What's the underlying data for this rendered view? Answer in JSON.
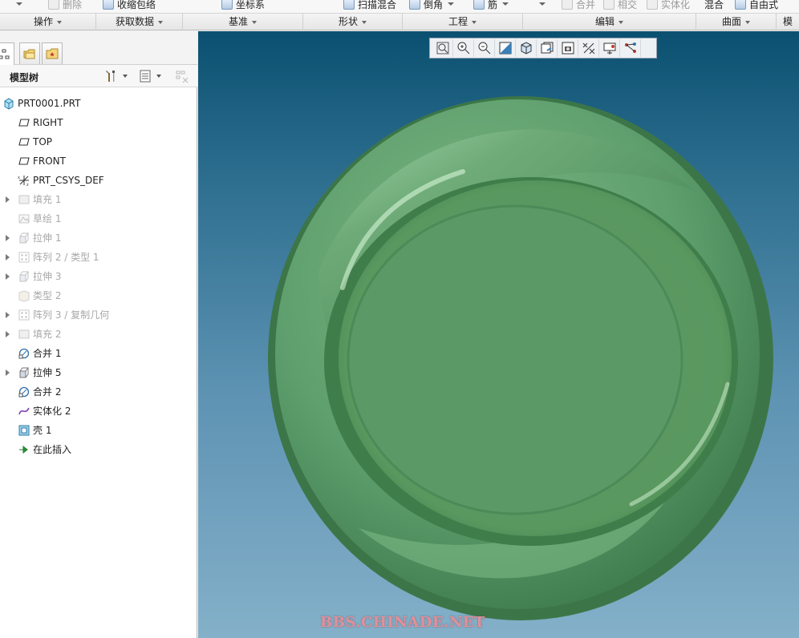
{
  "ribbon": {
    "top_items": [
      {
        "label": "删除",
        "dim": true
      },
      {
        "label": "收缩包络",
        "dim": false
      },
      {
        "label": "坐标系",
        "dim": false
      },
      {
        "label": "扫描混合",
        "dim": false
      },
      {
        "label": "倒角",
        "dim": false
      },
      {
        "label": "筋",
        "dim": false
      },
      {
        "label": "合并",
        "dim": true
      },
      {
        "label": "相交",
        "dim": true
      },
      {
        "label": "实体化",
        "dim": true
      },
      {
        "label": "混合",
        "dim": false
      },
      {
        "label": "自由式",
        "dim": false
      }
    ],
    "groups": [
      "操作",
      "获取数据",
      "基准",
      "形状",
      "工程",
      "编辑",
      "曲面",
      "模"
    ]
  },
  "panel": {
    "tree_title": "模型树"
  },
  "tree": [
    {
      "label": "PRT0001.PRT",
      "icon": "part-icon",
      "expand": false,
      "dim": false,
      "level": 0
    },
    {
      "label": "RIGHT",
      "icon": "datum-plane-icon",
      "expand": false,
      "dim": false,
      "level": 1
    },
    {
      "label": "TOP",
      "icon": "datum-plane-icon",
      "expand": false,
      "dim": false,
      "level": 1
    },
    {
      "label": "FRONT",
      "icon": "datum-plane-icon",
      "expand": false,
      "dim": false,
      "level": 1
    },
    {
      "label": "PRT_CSYS_DEF",
      "icon": "csys-icon",
      "expand": false,
      "dim": false,
      "level": 1
    },
    {
      "label": "填充 1",
      "icon": "fill-icon",
      "expand": true,
      "dim": true,
      "level": 1
    },
    {
      "label": "草绘 1",
      "icon": "sketch-icon",
      "expand": false,
      "dim": true,
      "level": 1
    },
    {
      "label": "拉伸 1",
      "icon": "extrude-icon",
      "expand": true,
      "dim": true,
      "level": 1
    },
    {
      "label": "阵列 2 / 类型 1",
      "icon": "pattern-icon",
      "expand": true,
      "dim": true,
      "level": 1
    },
    {
      "label": "拉伸 3",
      "icon": "extrude-icon",
      "expand": true,
      "dim": true,
      "level": 1
    },
    {
      "label": "类型 2",
      "icon": "type-icon",
      "expand": false,
      "dim": true,
      "level": 1
    },
    {
      "label": "阵列 3 / 复制几何",
      "icon": "pattern-icon",
      "expand": true,
      "dim": true,
      "level": 1
    },
    {
      "label": "填充 2",
      "icon": "fill-icon",
      "expand": true,
      "dim": true,
      "level": 1
    },
    {
      "label": "合并 1",
      "icon": "merge-icon",
      "expand": false,
      "dim": false,
      "level": 1
    },
    {
      "label": "拉伸 5",
      "icon": "extrude-icon",
      "expand": true,
      "dim": false,
      "level": 1
    },
    {
      "label": "合并 2",
      "icon": "merge-icon",
      "expand": false,
      "dim": false,
      "level": 1
    },
    {
      "label": "实体化 2",
      "icon": "solidify-icon",
      "expand": false,
      "dim": false,
      "level": 1
    },
    {
      "label": "壳 1",
      "icon": "shell-icon",
      "expand": false,
      "dim": false,
      "level": 1
    },
    {
      "label": "在此插入",
      "icon": "insert-here-icon",
      "expand": false,
      "dim": false,
      "level": 1
    }
  ],
  "view_toolbar": [
    "refit-icon",
    "zoom-in-icon",
    "zoom-out-icon",
    "repaint-icon",
    "display-style-icon",
    "saved-views-icon",
    "view-manager-icon",
    "datum-display-icon",
    "spin-center-icon",
    "annotation-display-icon"
  ],
  "watermark": "BBS.CHINADE.NET",
  "colors": {
    "model_green": "#5f9f6d",
    "viewport_top": "#0b5070",
    "viewport_bottom": "#84b0c9"
  }
}
